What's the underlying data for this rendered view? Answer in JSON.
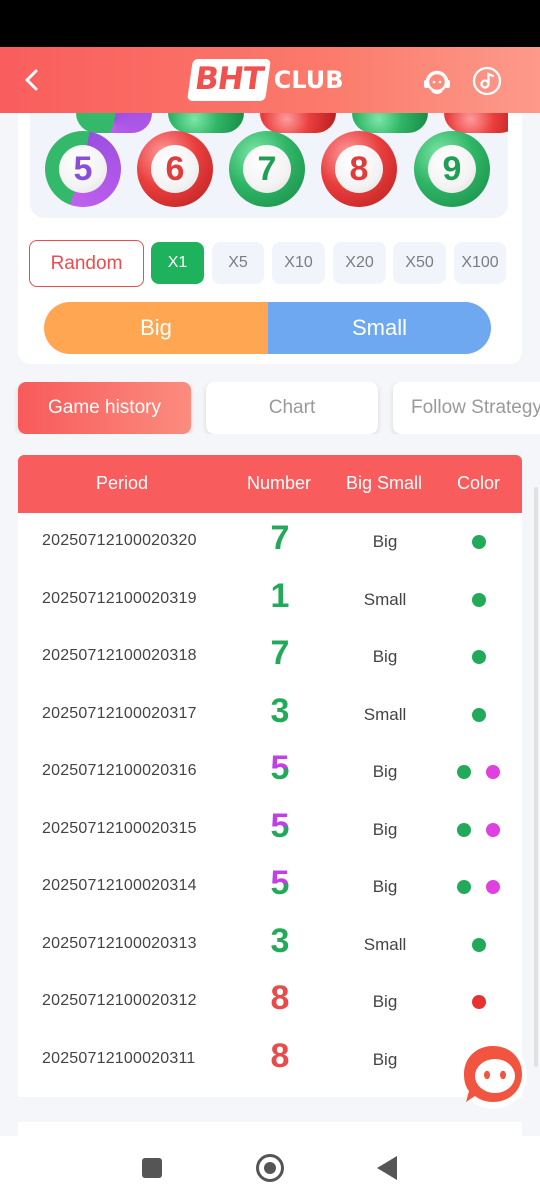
{
  "header": {
    "logo_box": "BHT",
    "logo_text": "CLUB"
  },
  "balls": {
    "visible": [
      {
        "number": "5",
        "color": "violet"
      },
      {
        "number": "6",
        "color": "red"
      },
      {
        "number": "7",
        "color": "green"
      },
      {
        "number": "8",
        "color": "red"
      },
      {
        "number": "9",
        "color": "green"
      }
    ]
  },
  "controls": {
    "random_label": "Random",
    "multipliers": [
      "X1",
      "X5",
      "X10",
      "X20",
      "X50",
      "X100"
    ],
    "selected_multiplier": "X1",
    "big_label": "Big",
    "small_label": "Small"
  },
  "tabs": {
    "game_history": "Game history",
    "chart": "Chart",
    "follow_strategy": "Follow Strategy",
    "active": "Game history"
  },
  "table": {
    "headers": {
      "period": "Period",
      "number": "Number",
      "big_small": "Big Small",
      "color": "Color"
    },
    "rows": [
      {
        "period": "20250712100020320",
        "number": "7",
        "big_small": "Big",
        "colors": [
          "green"
        ]
      },
      {
        "period": "20250712100020319",
        "number": "1",
        "big_small": "Small",
        "colors": [
          "green"
        ]
      },
      {
        "period": "20250712100020318",
        "number": "7",
        "big_small": "Big",
        "colors": [
          "green"
        ]
      },
      {
        "period": "20250712100020317",
        "number": "3",
        "big_small": "Small",
        "colors": [
          "green"
        ]
      },
      {
        "period": "20250712100020316",
        "number": "5",
        "big_small": "Big",
        "colors": [
          "green",
          "violet"
        ]
      },
      {
        "period": "20250712100020315",
        "number": "5",
        "big_small": "Big",
        "colors": [
          "green",
          "violet"
        ]
      },
      {
        "period": "20250712100020314",
        "number": "5",
        "big_small": "Big",
        "colors": [
          "green",
          "violet"
        ]
      },
      {
        "period": "20250712100020313",
        "number": "3",
        "big_small": "Small",
        "colors": [
          "green"
        ]
      },
      {
        "period": "20250712100020312",
        "number": "8",
        "big_small": "Big",
        "colors": [
          "red"
        ]
      },
      {
        "period": "20250712100020311",
        "number": "8",
        "big_small": "Big",
        "colors": [
          "red"
        ]
      }
    ]
  },
  "colors": {
    "accent_red": "#f95c5c",
    "green": "#22a95a",
    "red": "#e94b4b",
    "violet": "#e040e0",
    "big_orange": "#ffa652",
    "small_blue": "#6da8f0"
  }
}
